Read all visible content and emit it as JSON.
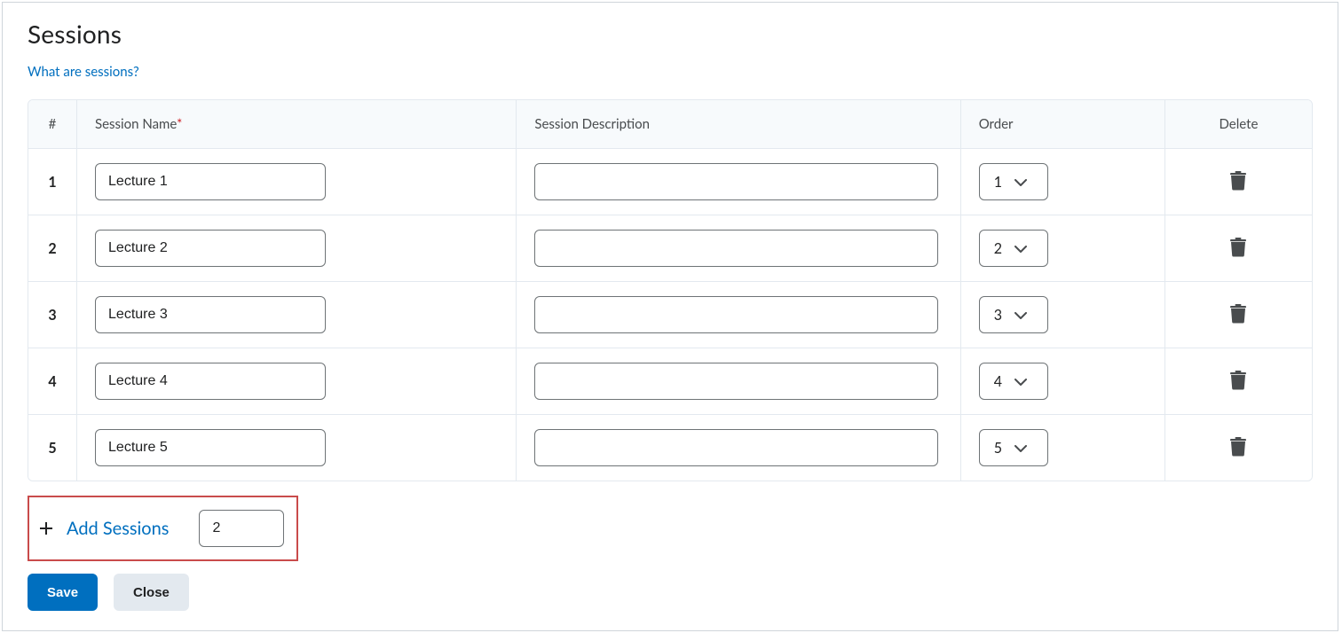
{
  "title": "Sessions",
  "help_link_text": "What are sessions?",
  "table": {
    "headers": {
      "number": "#",
      "name": "Session Name",
      "name_required_mark": "*",
      "description": "Session Description",
      "order": "Order",
      "delete": "Delete"
    },
    "rows": [
      {
        "num": "1",
        "name": "Lecture 1",
        "description": "",
        "order": "1"
      },
      {
        "num": "2",
        "name": "Lecture 2",
        "description": "",
        "order": "2"
      },
      {
        "num": "3",
        "name": "Lecture 3",
        "description": "",
        "order": "3"
      },
      {
        "num": "4",
        "name": "Lecture 4",
        "description": "",
        "order": "4"
      },
      {
        "num": "5",
        "name": "Lecture 5",
        "description": "",
        "order": "5"
      }
    ]
  },
  "add_sessions": {
    "label": "Add Sessions",
    "count": "2"
  },
  "buttons": {
    "save": "Save",
    "close": "Close"
  }
}
